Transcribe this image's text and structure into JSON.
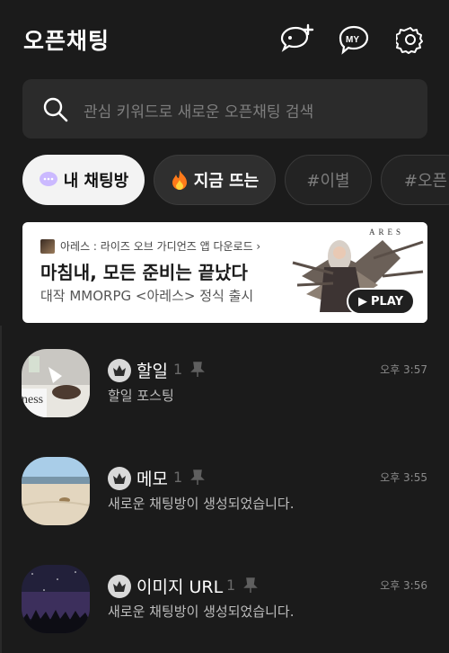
{
  "header": {
    "title": "오픈채팅",
    "icons": [
      "add-chat-icon",
      "my-icon",
      "settings-icon"
    ],
    "my_label": "MY"
  },
  "search": {
    "placeholder": "관심 키워드로 새로운 오픈채팅 검색"
  },
  "chips": [
    {
      "label": "내 채팅방",
      "emoji": "chat-bubble-icon",
      "state": "active"
    },
    {
      "label": "지금 뜨는",
      "emoji": "fire-icon",
      "state": "dark"
    },
    {
      "label": "#이별",
      "state": "outline"
    },
    {
      "label": "#오픈",
      "state": "outline"
    }
  ],
  "banner": {
    "small": "아레스 : 라이즈 오브 가디언즈 앱 다운로드 ›",
    "headline": "마침내, 모든 준비는 끝났다",
    "sub": "대작 MMORPG <아레스> 정식 출시",
    "brand": "ARES",
    "play": "PLAY"
  },
  "rooms": [
    {
      "name": "할일",
      "members": "1",
      "time": "오후 3:57",
      "preview": "할일 포스팅"
    },
    {
      "name": "메모",
      "members": "1",
      "time": "오후 3:55",
      "preview": "새로운 채팅방이 생성되었습니다."
    },
    {
      "name": "이미지 URL",
      "members": "1",
      "time": "오후 3:56",
      "preview": "새로운 채팅방이 생성되었습니다."
    }
  ],
  "colors": {
    "background": "#1b1b1b",
    "surface": "#2b2b2b",
    "chip_active": "#f3f3f3"
  }
}
